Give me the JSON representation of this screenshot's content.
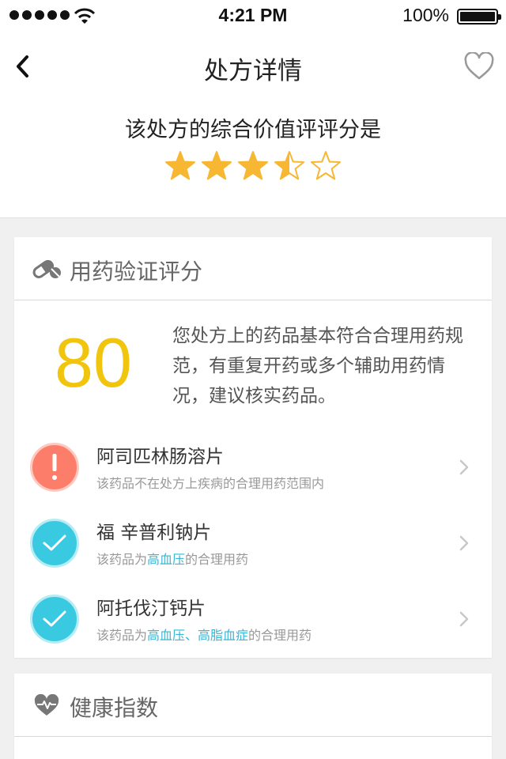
{
  "status_bar": {
    "time": "4:21 PM",
    "battery": "100%"
  },
  "nav": {
    "title": "处方详情"
  },
  "score_header": {
    "label": "该处方的综合价值评评分是",
    "rating_value": 3.5,
    "rating_max": 5,
    "star_color": "#f7b733"
  },
  "medication_card": {
    "title": "用药验证评分",
    "score": "80",
    "score_color": "#f1c50e",
    "summary": "您处方上的药品基本符合合理用药规范，有重复开药或多个辅助用药情况，建议核实药品。",
    "drugs": [
      {
        "name": "阿司匹林肠溶片",
        "status_icon": "exclamation-icon",
        "desc_pre": "该药品不在处方上疾病的合理用药范围内",
        "highlight": "",
        "desc_post": ""
      },
      {
        "name": "福 辛普利钠片",
        "status_icon": "check-icon",
        "desc_pre": "该药品为",
        "highlight": "高血压",
        "desc_post": "的合理用药"
      },
      {
        "name": "阿托伐汀钙片",
        "status_icon": "check-icon",
        "desc_pre": "该药品为",
        "highlight": "高血压、高脂血症",
        "desc_post": "的合理用药"
      }
    ]
  },
  "health_card": {
    "title": "健康指数"
  },
  "colors": {
    "warn": "#fc7d6a",
    "ok": "#39c9e0",
    "link": "#35b7d6"
  }
}
